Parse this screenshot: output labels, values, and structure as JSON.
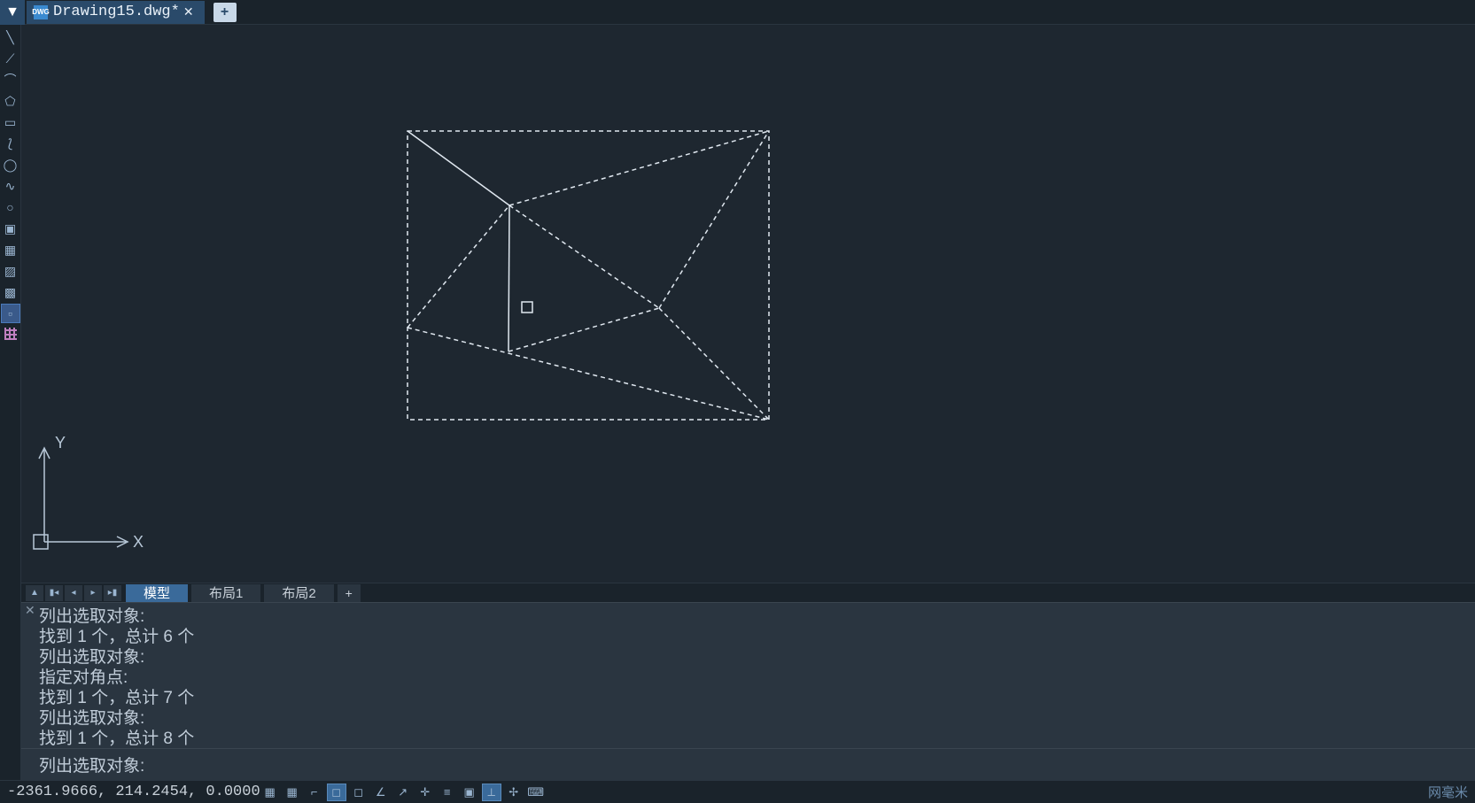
{
  "tab": {
    "icon_text": "DWG",
    "title": "Drawing15.dwg*"
  },
  "layout_tabs": {
    "model": "模型",
    "layout1": "布局1",
    "layout2": "布局2"
  },
  "ucs": {
    "y_label": "Y",
    "x_label": "X"
  },
  "command_history": [
    "列出选取对象:",
    "找到 1 个，总计 6 个",
    "列出选取对象:",
    "指定对角点:",
    "找到 1 个，总计 7 个",
    "列出选取对象:",
    "找到 1 个，总计 8 个"
  ],
  "command_prompt": "列出选取对象:",
  "status": {
    "coords": "-2361.9666, 214.2454, 0.0000",
    "right_text": "网毫米"
  },
  "tools": [
    "line",
    "polyline",
    "arc",
    "polygon",
    "rect",
    "spline",
    "ellipse",
    "wave",
    "circle",
    "block",
    "region",
    "hatch",
    "full",
    "highlight",
    "grid"
  ],
  "status_buttons": [
    "grid1",
    "grid2",
    "ortho",
    "snap",
    "polar",
    "angle",
    "track",
    "plus",
    "list",
    "color",
    "ruler",
    "layer",
    "kbd"
  ]
}
